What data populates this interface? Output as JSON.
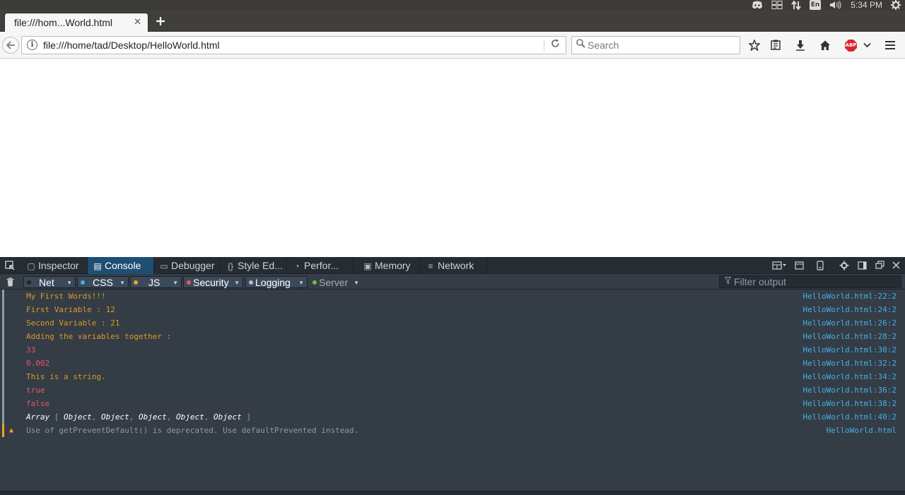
{
  "os_panel": {
    "clock": "5:34 PM",
    "keyboard_layout": "En"
  },
  "browser": {
    "tab_title": "file:///hom...World.html",
    "url": "file:///home/tad/Desktop/HelloWorld.html",
    "search_placeholder": "Search",
    "abp_label": "ABP"
  },
  "devtools": {
    "tabs": [
      {
        "label": "Inspector"
      },
      {
        "label": "Console"
      },
      {
        "label": "Debugger"
      },
      {
        "label": "Style Ed..."
      },
      {
        "label": "Perfor..."
      },
      {
        "label": "Memory"
      },
      {
        "label": "Network"
      }
    ],
    "selected_tab": "Console",
    "filters": [
      {
        "label": "Net",
        "dot_color": "#222222"
      },
      {
        "label": "CSS",
        "dot_color": "#46afe3"
      },
      {
        "label": "JS",
        "dot_color": "#f0a02a"
      },
      {
        "label": "Security",
        "dot_color": "#eb5368"
      },
      {
        "label": "Logging",
        "dot_color": "#b6babf"
      },
      {
        "label": "Server",
        "dot_color": "#70bf53"
      }
    ],
    "filter_output_placeholder": "Filter output",
    "console": [
      {
        "message": "My First Words!!!",
        "source": "HelloWorld.html:22:2",
        "kind": "string"
      },
      {
        "message": "First Variable : 12",
        "source": "HelloWorld.html:24:2",
        "kind": "string"
      },
      {
        "message": "Second Variable : 21",
        "source": "HelloWorld.html:26:2",
        "kind": "string"
      },
      {
        "message": "Adding the variables together :",
        "source": "HelloWorld.html:28:2",
        "kind": "string"
      },
      {
        "message": "33",
        "source": "HelloWorld.html:30:2",
        "kind": "number"
      },
      {
        "message": "0.002",
        "source": "HelloWorld.html:32:2",
        "kind": "number"
      },
      {
        "message": "This is a string.",
        "source": "HelloWorld.html:34:2",
        "kind": "string"
      },
      {
        "message": "true",
        "source": "HelloWorld.html:36:2",
        "kind": "boolean"
      },
      {
        "message": "false",
        "source": "HelloWorld.html:38:2",
        "kind": "boolean"
      },
      {
        "message": "Array [ Object, Object, Object, Object, Object ]",
        "source": "HelloWorld.html:40:2",
        "kind": "array",
        "array_label": "Array",
        "array_items": [
          "Object",
          "Object",
          "Object",
          "Object",
          "Object"
        ]
      },
      {
        "message": "Use of getPreventDefault() is deprecated. Use defaultPrevented instead.",
        "source": "HelloWorld.html",
        "kind": "warning"
      }
    ]
  },
  "colors": {
    "devtools_bg": "#343c45",
    "toolbar_bg": "#252c33",
    "selected_tab": "#1d4f73",
    "string_text": "#d99b28",
    "number_text": "#eb5368",
    "source_link": "#46afe3",
    "warning_gutter": "#f0a02a"
  }
}
